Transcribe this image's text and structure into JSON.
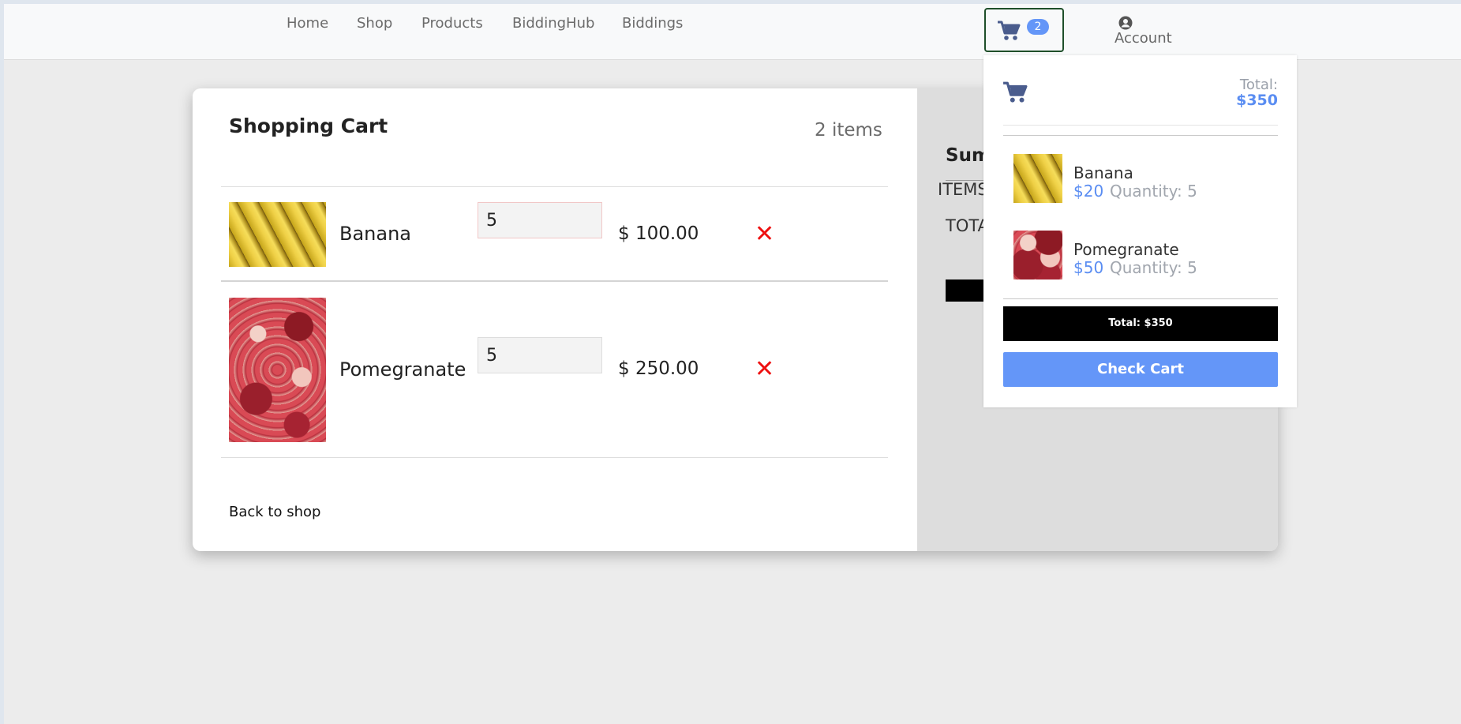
{
  "nav": {
    "links": [
      "Home",
      "Shop",
      "Products",
      "BiddingHub",
      "Biddings"
    ],
    "cart_badge": "2",
    "account_label": "Account"
  },
  "cart": {
    "title": "Shopping Cart",
    "items_count": "2 items",
    "items": [
      {
        "name": "Banana",
        "quantity": "5",
        "price": "$ 100.00",
        "remove": "✕"
      },
      {
        "name": "Pomegranate",
        "quantity": "5",
        "price": "$ 250.00",
        "remove": "✕"
      }
    ],
    "back_link": "Back to shop"
  },
  "summary": {
    "title_partial": "Sum",
    "items_partial": "ITEMS",
    "total_partial": "TOTA"
  },
  "dropdown": {
    "total_label": "Total:",
    "total_value": "$350",
    "items": [
      {
        "name": "Banana",
        "price": "$20",
        "quantity": "Quantity: 5"
      },
      {
        "name": "Pomegranate",
        "price": "$50",
        "quantity": "Quantity: 5"
      }
    ],
    "total_button": "Total: $350",
    "check_cart_button": "Check Cart"
  },
  "colors": {
    "accent_blue": "#6496f8",
    "cart_icon": "#4a5c8d",
    "remove_red": "#e11111"
  }
}
